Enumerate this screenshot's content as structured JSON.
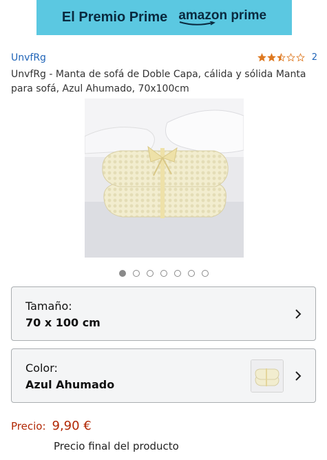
{
  "banner": {
    "text": "El Premio Prime",
    "logo_text": "amazon prime",
    "color": "#5bc8e1"
  },
  "product": {
    "brand": "UnvfRg",
    "rating": 2.5,
    "rating_count": "2",
    "title": "UnvfRg - Manta de sofá de Doble Capa, cálida y sólida Manta para sofá, Azul Ahumado, 70x100cm",
    "image": "cream-fleece-blanket-photo",
    "carousel": {
      "count": 7,
      "active": 1
    }
  },
  "options": {
    "size": {
      "label": "Tamaño:",
      "value": "70 x 100 cm"
    },
    "color": {
      "label": "Color:",
      "value": "Azul Ahumado",
      "thumbnail": "blanket-thumbnail"
    }
  },
  "price": {
    "label": "Precio:",
    "value": "9,90 €",
    "note": "Precio final del producto",
    "color": "#b12704"
  },
  "colors": {
    "link": "#2165b8",
    "star": "#de7921"
  }
}
